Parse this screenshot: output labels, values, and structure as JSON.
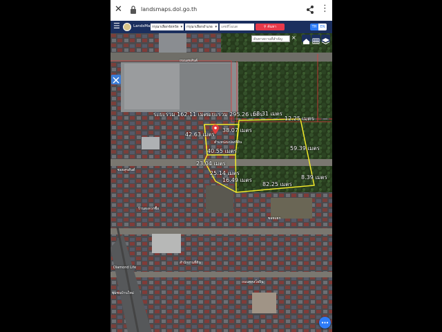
{
  "browser": {
    "url": "landsmaps.dol.go.th",
    "icons": [
      "close-icon",
      "lock-icon",
      "share-icon",
      "more-icon"
    ]
  },
  "toolbar": {
    "app_name": "LandsMaps",
    "province_select": "กรุณาเลือกจังหวัด",
    "district_select": "กรุณาเลือกอำเภอ",
    "parcel_placeholder": "เลขที่โฉนด",
    "search_label": "ค้นหา",
    "lang_th": "TH",
    "lang_en": "EN"
  },
  "map": {
    "search_placeholder": "ค้นหาสถานที่สำคัญ",
    "search_close": "×",
    "total_area_1": "ระยะรวม 162.11 เมตร",
    "total_area_2": "ระยะรวม 295.26 เมตร",
    "pin_label": "ตำแหน่งแปลงที่ดิน",
    "road_label_top": "ถนนสุขสันต์",
    "road_label_mid": "ซอยสุขสันต์",
    "place_label_1": "ร้านสะดวกซื้อ",
    "place_label_2": "ซอยแยก",
    "place_label_3": "สำนักงานที่ดิน",
    "place_label_4": "Diamond Life",
    "place_label_5": "ชุมชนบ้านใหม่",
    "place_label_6": "ถนนพหลโยธิน",
    "measurements": {
      "m1": "68.31 เมตร",
      "m2": "12.25 เมตร",
      "m3": "42.63 เมตร",
      "m4": "38.07 เมตร",
      "m5": "40.55 เมตร",
      "m6": "59.39 เมตร",
      "m7": "23.04 เมตร",
      "m8": "25.14 เมตร",
      "m9": "16.49 เมตร",
      "m10": "82.25 เมตร",
      "m11": "8.39 เมตร"
    },
    "colors": {
      "parcel_outline": "#f3ea2a",
      "boundary": "#e23b3b",
      "toolbar": "#1b2f5e",
      "accent": "#2e7cf6"
    }
  }
}
